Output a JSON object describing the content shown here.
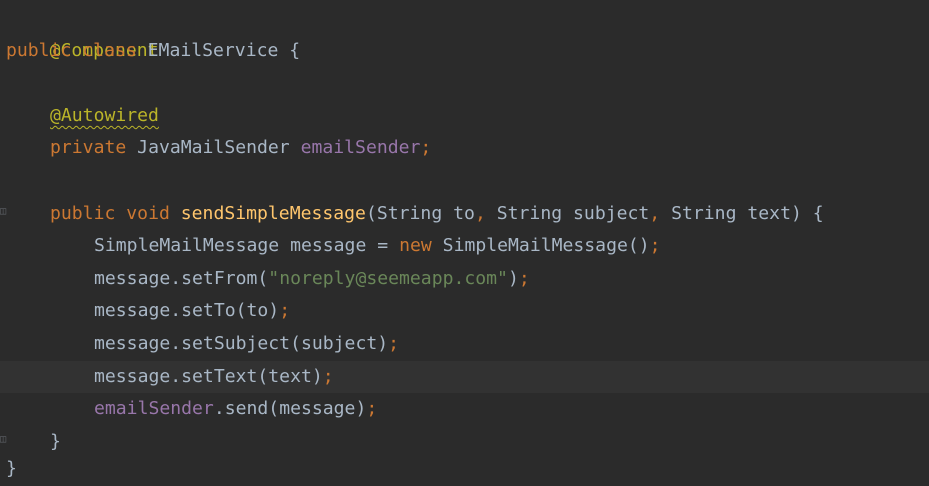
{
  "code": {
    "line1": {
      "annotation": "@Component"
    },
    "line2": {
      "kw_public": "public",
      "kw_class": "class",
      "class_name": "EMailService",
      "brace": "{"
    },
    "line4": {
      "annotation": "@Autowired"
    },
    "line5": {
      "kw_private": "private",
      "type": "JavaMailSender",
      "field": "emailSender",
      "semi": ";"
    },
    "line7": {
      "kw_public": "public",
      "kw_void": "void",
      "method": "sendSimpleMessage",
      "paren_open": "(",
      "p1_type": "String",
      "p1_name": "to",
      "comma1": ",",
      "p2_type": "String",
      "p2_name": "subject",
      "comma2": ",",
      "p3_type": "String",
      "p3_name": "text",
      "paren_close": ")",
      "brace": "{"
    },
    "line8": {
      "type": "SimpleMailMessage",
      "var": "message",
      "eq": "=",
      "kw_new": "new",
      "ctor": "SimpleMailMessage()",
      "semi": ";"
    },
    "line9": {
      "call": "message.setFrom(",
      "string": "\"noreply@seemeapp.com\"",
      "close": ")",
      "semi": ";"
    },
    "line10": {
      "call": "message.setTo(to)",
      "semi": ";"
    },
    "line11": {
      "call": "message.setSubject(subject)",
      "semi": ";"
    },
    "line12": {
      "call": "message.setText(text)",
      "semi": ";"
    },
    "line13": {
      "field": "emailSender",
      "call": ".send(message)",
      "semi": ";"
    },
    "line14": {
      "brace": "}"
    },
    "line15": {
      "brace": "}"
    }
  },
  "colors": {
    "background": "#2b2b2b",
    "current_line": "#323232",
    "keyword": "#cc7832",
    "annotation": "#bbb529",
    "field": "#9876aa",
    "method_decl": "#ffc66d",
    "string": "#6a8759",
    "default_text": "#a9b7c6"
  },
  "icons": {
    "fold_method": "fold-marker-icon",
    "fold_end": "fold-end-icon"
  }
}
